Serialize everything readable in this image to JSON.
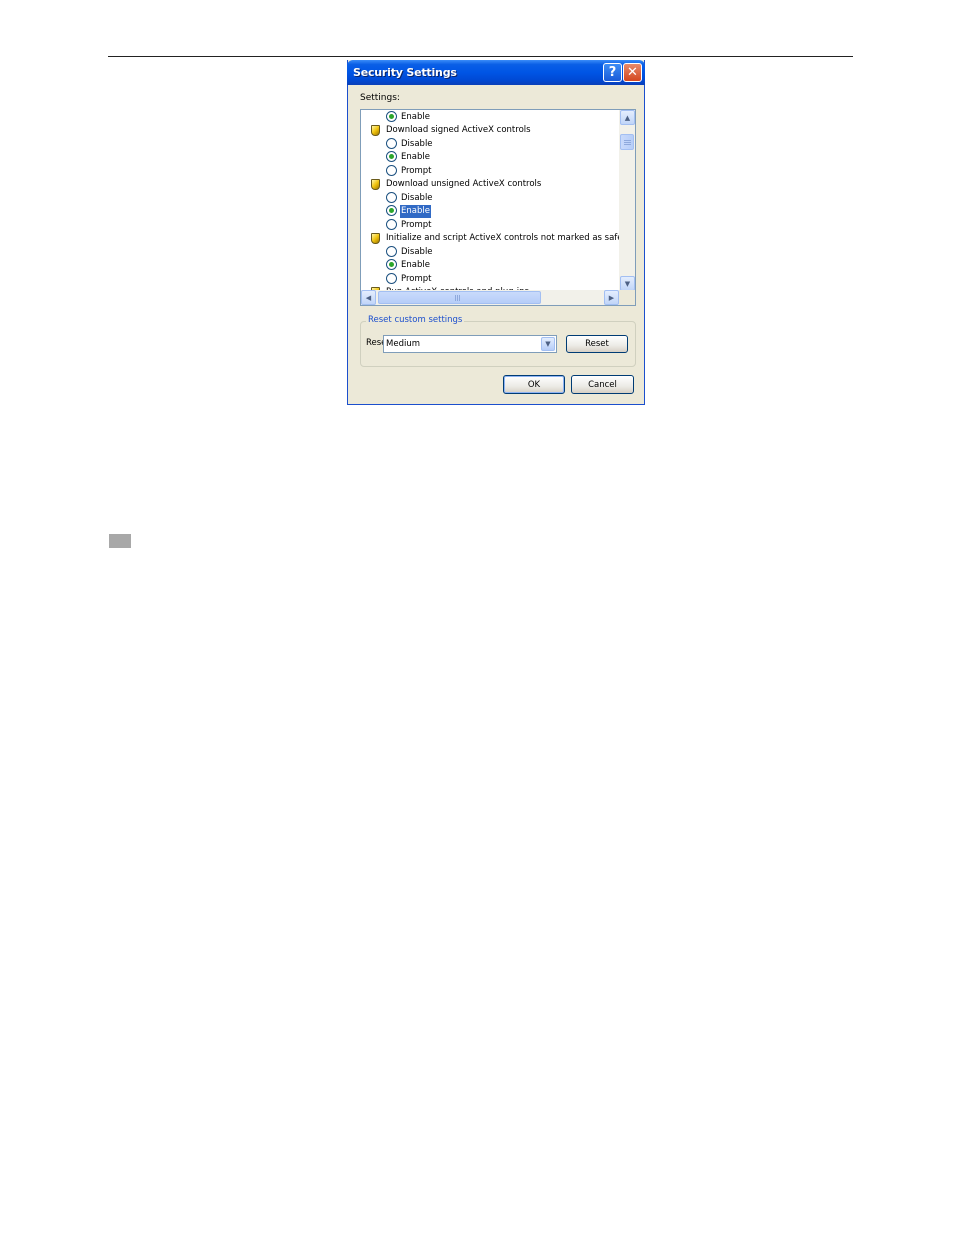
{
  "dialog": {
    "title": "Security Settings",
    "help_button": "?",
    "close_button": "✕",
    "settings_label": "Settings:",
    "list": {
      "rows": [
        {
          "kind": "radio",
          "label": "Enable",
          "checked": true
        },
        {
          "kind": "header",
          "label": "Download signed ActiveX controls"
        },
        {
          "kind": "radio",
          "label": "Disable",
          "checked": false
        },
        {
          "kind": "radio",
          "label": "Enable",
          "checked": true
        },
        {
          "kind": "radio",
          "label": "Prompt",
          "checked": false
        },
        {
          "kind": "header",
          "label": "Download unsigned ActiveX controls"
        },
        {
          "kind": "radio",
          "label": "Disable",
          "checked": false
        },
        {
          "kind": "radio",
          "label": "Enable",
          "checked": true,
          "selected": true
        },
        {
          "kind": "radio",
          "label": "Prompt",
          "checked": false
        },
        {
          "kind": "header",
          "label": "Initialize and script ActiveX controls not marked as safe"
        },
        {
          "kind": "radio",
          "label": "Disable",
          "checked": false
        },
        {
          "kind": "radio",
          "label": "Enable",
          "checked": true
        },
        {
          "kind": "radio",
          "label": "Prompt",
          "checked": false
        },
        {
          "kind": "header",
          "label": "Run ActiveX controls and plug-ins"
        }
      ]
    },
    "reset_group": {
      "legend": "Reset custom settings",
      "reset_to_label": "Reset to:",
      "selected_level": "Medium",
      "reset_button": "Reset"
    },
    "ok_button": "OK",
    "cancel_button": "Cancel",
    "icons": {
      "shield": "security-shield-icon",
      "scroll_up": "▲",
      "scroll_down": "▼",
      "scroll_left": "◀",
      "scroll_right": "▶",
      "dropdown": "▼"
    },
    "colors": {
      "titlebar": "#0055e5",
      "selection": "#316ac5",
      "radio_dot": "#2ba52b",
      "group_legend": "#1c4fcd"
    }
  }
}
